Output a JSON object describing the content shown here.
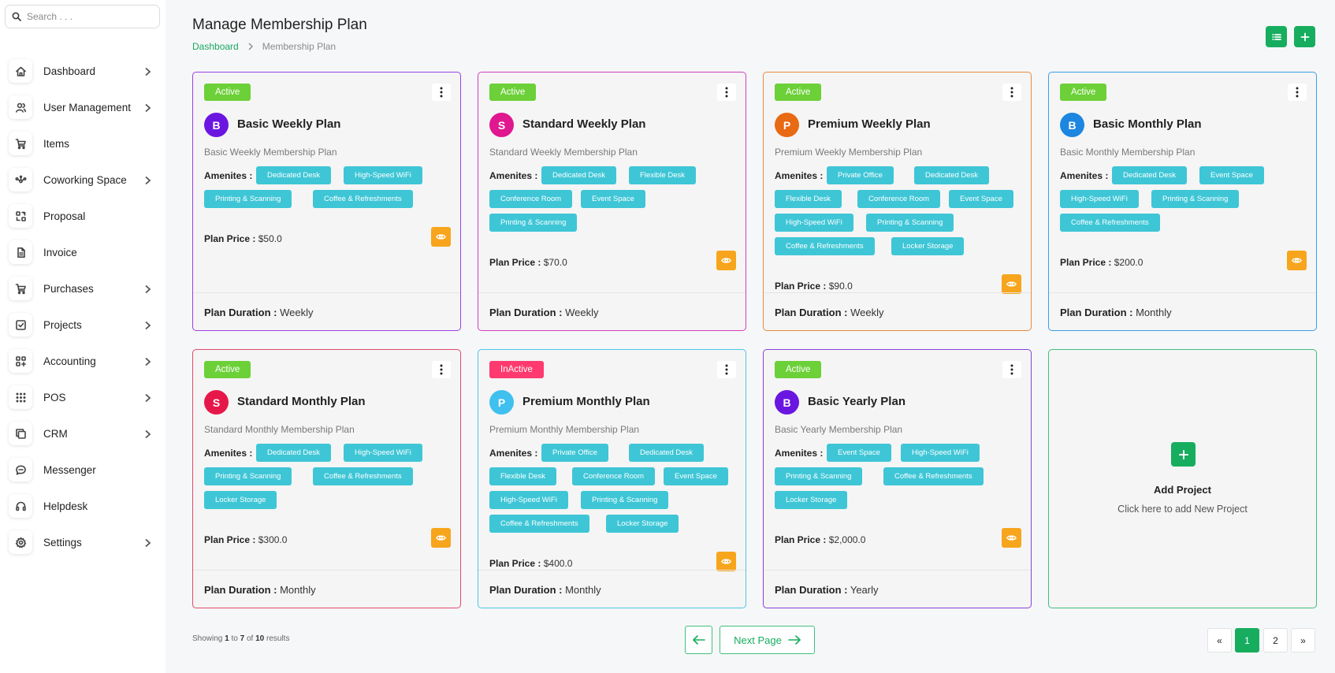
{
  "search": {
    "placeholder": "Search . . ."
  },
  "sidebar": {
    "items": [
      {
        "label": "Dashboard",
        "icon": "home-icon",
        "chevron": true
      },
      {
        "label": "User Management",
        "icon": "users-icon",
        "chevron": true
      },
      {
        "label": "Items",
        "icon": "cart-icon",
        "chevron": false
      },
      {
        "label": "Coworking Space",
        "icon": "network-icon",
        "chevron": true
      },
      {
        "label": "Proposal",
        "icon": "proposal-icon",
        "chevron": false
      },
      {
        "label": "Invoice",
        "icon": "file-icon",
        "chevron": false
      },
      {
        "label": "Purchases",
        "icon": "shopping-cart-icon",
        "chevron": true
      },
      {
        "label": "Projects",
        "icon": "checklist-icon",
        "chevron": true
      },
      {
        "label": "Accounting",
        "icon": "apps-icon",
        "chevron": true
      },
      {
        "label": "POS",
        "icon": "grid-dots-icon",
        "chevron": true
      },
      {
        "label": "CRM",
        "icon": "copy-icon",
        "chevron": true
      },
      {
        "label": "Messenger",
        "icon": "chat-icon",
        "chevron": false
      },
      {
        "label": "Helpdesk",
        "icon": "headset-icon",
        "chevron": false
      },
      {
        "label": "Settings",
        "icon": "gear-icon",
        "chevron": true
      }
    ]
  },
  "header": {
    "title": "Manage Membership Plan",
    "breadcrumb": {
      "home": "Dashboard",
      "current": "Membership Plan"
    }
  },
  "labels": {
    "amenities": "Amenites :",
    "plan_price": "Plan Price :",
    "plan_duration": "Plan Duration :"
  },
  "colors": {
    "accent": "#17ad5f",
    "active_badge": "#6cd038",
    "inactive_badge": "#ff3a6e",
    "chip": "#3ec6d6",
    "eye_button": "#f7a51c"
  },
  "plans": [
    {
      "status": "Active",
      "initial": "B",
      "name": "Basic Weekly Plan",
      "description": "Basic Weekly Membership Plan",
      "amenities": [
        "Dedicated Desk",
        "High-Speed WiFi",
        "Printing & Scanning",
        "Coffee & Refreshments"
      ],
      "price": "$50.0",
      "duration": "Weekly",
      "border_color": "#9b3fe6",
      "avatar_color": "#6b16e0"
    },
    {
      "status": "Active",
      "initial": "S",
      "name": "Standard Weekly Plan",
      "description": "Standard Weekly Membership Plan",
      "amenities": [
        "Dedicated Desk",
        "Flexible Desk",
        "Conference Room",
        "Event Space",
        "Printing & Scanning"
      ],
      "price": "$70.0",
      "duration": "Weekly",
      "border_color": "#d23ec0",
      "avatar_color": "#e0178f"
    },
    {
      "status": "Active",
      "initial": "P",
      "name": "Premium Weekly Plan",
      "description": "Premium Weekly Membership Plan",
      "amenities": [
        "Private Office",
        "Dedicated Desk",
        "Flexible Desk",
        "Conference Room",
        "Event Space",
        "High-Speed WiFi",
        "Printing & Scanning",
        "Coffee & Refreshments",
        "Locker Storage"
      ],
      "price": "$90.0",
      "duration": "Weekly",
      "border_color": "#ea8a3c",
      "avatar_color": "#e86a13"
    },
    {
      "status": "Active",
      "initial": "B",
      "name": "Basic Monthly Plan",
      "description": "Basic Monthly Membership Plan",
      "amenities": [
        "Dedicated Desk",
        "Event Space",
        "High-Speed WiFi",
        "Printing & Scanning",
        "Coffee & Refreshments"
      ],
      "price": "$200.0",
      "duration": "Monthly",
      "border_color": "#3a9ee6",
      "avatar_color": "#1c86e0"
    },
    {
      "status": "Active",
      "initial": "S",
      "name": "Standard Monthly Plan",
      "description": "Standard Monthly Membership Plan",
      "amenities": [
        "Dedicated Desk",
        "High-Speed WiFi",
        "Printing & Scanning",
        "Coffee & Refreshments",
        "Locker Storage"
      ],
      "price": "$300.0",
      "duration": "Monthly",
      "border_color": "#e04a6a",
      "avatar_color": "#e6184a"
    },
    {
      "status": "InActive",
      "initial": "P",
      "name": "Premium Monthly Plan",
      "description": "Premium Monthly Membership Plan",
      "amenities": [
        "Private Office",
        "Dedicated Desk",
        "Flexible Desk",
        "Conference Room",
        "Event Space",
        "High-Speed WiFi",
        "Printing & Scanning",
        "Coffee & Refreshments",
        "Locker Storage"
      ],
      "price": "$400.0",
      "duration": "Monthly",
      "border_color": "#4cc6e6",
      "avatar_color": "#3fc0ee"
    },
    {
      "status": "Active",
      "initial": "B",
      "name": "Basic Yearly Plan",
      "description": "Basic Yearly Membership Plan",
      "amenities": [
        "Event Space",
        "High-Speed WiFi",
        "Printing & Scanning",
        "Coffee & Refreshments",
        "Locker Storage"
      ],
      "price": "$2,000.0",
      "duration": "Yearly",
      "border_color": "#8a3fdc",
      "avatar_color": "#6b16e0"
    }
  ],
  "add_card": {
    "title": "Add Project",
    "subtitle": "Click here to add New Project"
  },
  "footer": {
    "results_prefix": "Showing",
    "from": "1",
    "to_word": "to",
    "to": "7",
    "of_word": "of",
    "total": "10",
    "results_suffix": "results",
    "next_label": "Next Page",
    "pages": [
      "1",
      "2"
    ],
    "current_page": "1",
    "first_label": "«",
    "last_label": "»"
  }
}
